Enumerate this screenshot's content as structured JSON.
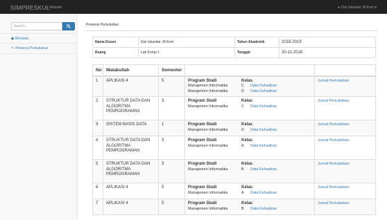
{
  "navbar": {
    "brand": "SIMPRESKUL",
    "website": "Website",
    "user": "Dwi Iskandar, M.Kom"
  },
  "sidebar": {
    "search_placeholder": "Search...",
    "items": [
      {
        "label": "Beranda",
        "icon": "dashboard-icon"
      },
      {
        "label": "Presensi Perkuliahan",
        "icon": "edit-icon"
      }
    ]
  },
  "page": {
    "title": "Presensi Perkuliahan"
  },
  "info": {
    "nama_dosen_label": "Nama Dosen",
    "nama_dosen": "Dwi Iskandar, M.Kom",
    "tahun_label": "Tahun Akademik",
    "tahun": "2018-2019",
    "ruang_label": "Ruang",
    "ruang": "Lab Komp 1",
    "tanggal_label": "Tanggal",
    "tanggal": "30-11-2018"
  },
  "table": {
    "headers": {
      "no": "No",
      "matakuliah": "Matakuliah",
      "semester": "Semester"
    },
    "ps_head": "Program Studi",
    "kelas_head": "Kelas",
    "rows": [
      {
        "no": "1",
        "mk": "APLIKASI 4",
        "sem": "5",
        "ps": [
          "Manajemen Informatika",
          "Manajemen Informatika"
        ],
        "kelas": [
          "C",
          "D"
        ],
        "link": "Data Kehadiran",
        "jurnal": "Jurnal Perkuliahan"
      },
      {
        "no": "2",
        "mk": "STRUKTUR DATA DAN ALGORITMA PEMROGRAMAN",
        "sem": "3",
        "ps": [
          "Manajemen Informatika"
        ],
        "kelas": [
          "C"
        ],
        "link": "Data Kehadiran",
        "jurnal": "Jurnal Perkuliahan"
      },
      {
        "no": "3",
        "mk": "SISTEM BASIS DATA",
        "sem": "1",
        "ps": [
          "Manajemen Informatika"
        ],
        "kelas": [
          "D"
        ],
        "link": "Data Kehadiran",
        "jurnal": "Jurnal Perkuliahan"
      },
      {
        "no": "4",
        "mk": "STRUKTUR DATA DAN ALGORITMA PEMROGRAMAN",
        "sem": "3",
        "ps": [
          "Manajemen Informatika"
        ],
        "kelas": [
          "A"
        ],
        "link": "Data Kehadiran",
        "jurnal": "Jurnal Perkuliahan"
      },
      {
        "no": "5",
        "mk": "STRUKTUR DATA DAN ALGORITMA PEMROGRAMAN",
        "sem": "3",
        "ps": [
          "Manajemen Informatika"
        ],
        "kelas": [
          "B"
        ],
        "link": "Data Kehadiran",
        "jurnal": "Jurnal Perkuliahan"
      },
      {
        "no": "6",
        "mk": "APLIKASI 4",
        "sem": "5",
        "ps": [
          "Manajemen Informatika"
        ],
        "kelas": [
          "A"
        ],
        "link": "Data Kehadiran",
        "jurnal": "Jurnal Perkuliahan"
      },
      {
        "no": "7",
        "mk": "APLIKASI 4",
        "sem": "5",
        "ps": [
          "Manajemen Informatika"
        ],
        "kelas": [
          "B"
        ],
        "link": "Data Kehadiran",
        "jurnal": "Jurnal Perkuliahan"
      }
    ]
  }
}
